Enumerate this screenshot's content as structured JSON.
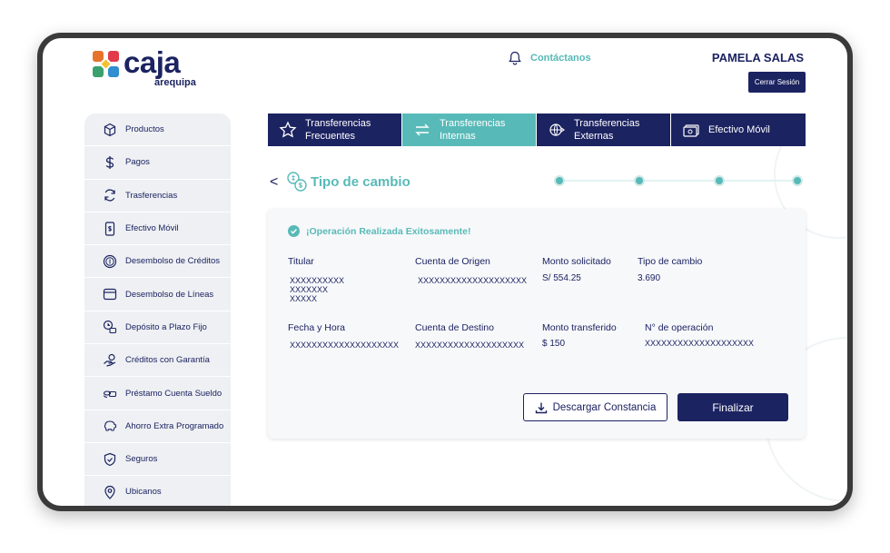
{
  "header": {
    "logo_main": "caja",
    "logo_sub": "arequipa",
    "contact_label": "Contáctanos",
    "user_name": "PAMELA SALAS",
    "logout_label": "Cerrar Sesión"
  },
  "sidebar": {
    "items": [
      {
        "label": "Productos",
        "icon": "cube-icon"
      },
      {
        "label": "Pagos",
        "icon": "dollar-icon"
      },
      {
        "label": "Trasferencias",
        "icon": "refresh-icon"
      },
      {
        "label": "Efectivo Móvil",
        "icon": "mobile-cash-icon"
      },
      {
        "label": "Desembolso de Créditos",
        "icon": "coin-icon"
      },
      {
        "label": "Desembolso de Líneas",
        "icon": "wallet-icon"
      },
      {
        "label": "Depósito a Plazo Fijo",
        "icon": "deposit-icon"
      },
      {
        "label": "Créditos con Garantía",
        "icon": "guarantee-icon"
      },
      {
        "label": "Préstamo Cuenta Sueldo",
        "icon": "cash-stack-icon"
      },
      {
        "label": "Ahorro Extra Programado",
        "icon": "piggy-bank-icon"
      },
      {
        "label": "Seguros",
        "icon": "shield-icon"
      },
      {
        "label": "Ubicanos",
        "icon": "location-pin-icon"
      }
    ]
  },
  "tabs": [
    {
      "line1": "Transferencias",
      "line2": "Frecuentes",
      "icon": "star-icon",
      "active": false
    },
    {
      "line1": "Transferencias",
      "line2": "Internas",
      "icon": "arrows-exchange-icon",
      "active": true
    },
    {
      "line1": "Transferencias",
      "line2": "Externas",
      "icon": "globe-icon",
      "active": false
    },
    {
      "line1": "Efectivo Móvil",
      "line2": "",
      "icon": "cash-icon",
      "active": false
    }
  ],
  "page": {
    "back_label": "<",
    "title": "Tipo de cambio",
    "steps_total": 4
  },
  "result": {
    "success_message": "¡Operación Realizada Exitosamente!",
    "fields": {
      "titular": {
        "label": "Titular",
        "value": "XXXXXXXXXX\nXXXXXXX\nXXXXX"
      },
      "cuenta_origen": {
        "label": "Cuenta de Origen",
        "value": "XXXXXXXXXXXXXXXXXXXX"
      },
      "monto_solicitado": {
        "label": "Monto solicitado",
        "value": "S/ 554.25"
      },
      "tipo_cambio": {
        "label": "Tipo de cambio",
        "value": "3.690"
      },
      "fecha_hora": {
        "label": "Fecha y Hora",
        "value": "XXXXXXXXXXXXXXXXXXXX"
      },
      "cuenta_destino": {
        "label": "Cuenta de Destino",
        "value": "XXXXXXXXXXXXXXXXXXXX"
      },
      "monto_transferido": {
        "label": "Monto transferido",
        "value": "$ 150"
      },
      "numero_operacion": {
        "label": "N° de operación",
        "value": "XXXXXXXXXXXXXXXXXXXX"
      }
    },
    "download_label": "Descargar Constancia",
    "finish_label": "Finalizar"
  },
  "colors": {
    "navy": "#1c2361",
    "teal": "#58bab8",
    "sidebar_bg": "#eef0f3"
  }
}
